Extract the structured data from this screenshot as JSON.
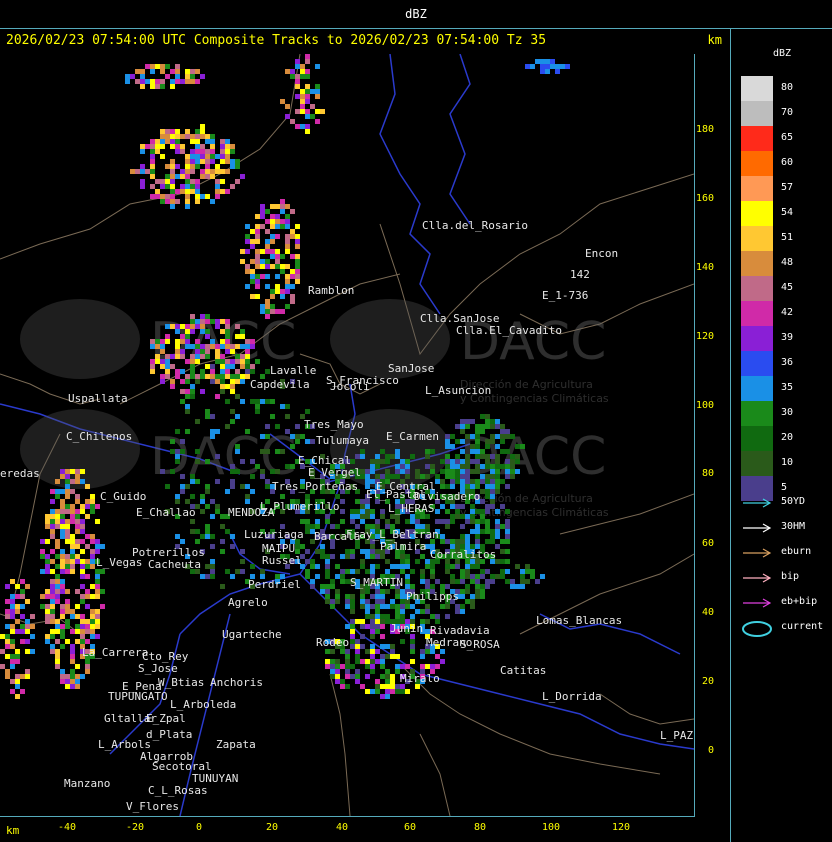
{
  "title": "dBZ",
  "header": {
    "text": "2026/02/23 07:54:00 UTC Composite Tracks to 2026/02/23 07:54:00 Tz 35",
    "unit": "km"
  },
  "x_axis": {
    "unit": "km",
    "ticks": [
      "-40",
      "-20",
      "0",
      "20",
      "40",
      "60",
      "80",
      "100",
      "120"
    ]
  },
  "y_axis": {
    "ticks": [
      "180",
      "160",
      "140",
      "120",
      "100",
      "80",
      "60",
      "40",
      "20",
      "0"
    ]
  },
  "legend": {
    "title": "dBZ",
    "levels": [
      {
        "label": "80",
        "color": "#d9d9d9"
      },
      {
        "label": "70",
        "color": "#bdbdbd"
      },
      {
        "label": "65",
        "color": "#ff2a1a"
      },
      {
        "label": "60",
        "color": "#ff6a00"
      },
      {
        "label": "57",
        "color": "#ff9955"
      },
      {
        "label": "54",
        "color": "#ffff00"
      },
      {
        "label": "51",
        "color": "#ffc832"
      },
      {
        "label": "48",
        "color": "#d88c3c"
      },
      {
        "label": "45",
        "color": "#c06a88"
      },
      {
        "label": "42",
        "color": "#d02aa8"
      },
      {
        "label": "39",
        "color": "#8a1fd6"
      },
      {
        "label": "36",
        "color": "#2a4cf0"
      },
      {
        "label": "35",
        "color": "#1a90e6"
      },
      {
        "label": "30",
        "color": "#1a8a1a"
      },
      {
        "label": "20",
        "color": "#106a10"
      },
      {
        "label": "10",
        "color": "#2a5a1a"
      },
      {
        "label": "5",
        "color": "#4a3e8c"
      }
    ],
    "tracks": [
      {
        "label": "50YD",
        "color": "#40d0e0"
      },
      {
        "label": "30HM",
        "color": "#ffffff"
      },
      {
        "label": "eburn",
        "color": "#d8a060"
      },
      {
        "label": "bip",
        "color": "#ffb0c0"
      },
      {
        "label": "eb+bip",
        "color": "#e040e0"
      },
      {
        "label": "current",
        "color": "#40d0e0"
      }
    ]
  },
  "places": [
    {
      "name": "Clla.del_Rosario"
    },
    {
      "name": "Encon"
    },
    {
      "name": "142"
    },
    {
      "name": "E_1-736"
    },
    {
      "name": "Ramblon"
    },
    {
      "name": "Clla.SanJose"
    },
    {
      "name": "Clla.El_Cavadito"
    },
    {
      "name": "S_Francisco"
    },
    {
      "name": "SanJose"
    },
    {
      "name": "L_Asuncion"
    },
    {
      "name": "Uspallata"
    },
    {
      "name": "Tres_Mayo"
    },
    {
      "name": "Tulumaya"
    },
    {
      "name": "E_Carmen"
    },
    {
      "name": "C_Chilenos"
    },
    {
      "name": "E_Chical"
    },
    {
      "name": "E_Vergel"
    },
    {
      "name": "Divisadero"
    },
    {
      "name": "E_Central"
    },
    {
      "name": "C_Guido"
    },
    {
      "name": "E_Challao"
    },
    {
      "name": "MENDOZA"
    },
    {
      "name": "Potrerillos"
    },
    {
      "name": "Cacheuta"
    },
    {
      "name": "Luzuriaga"
    },
    {
      "name": "MAIPU"
    },
    {
      "name": "Russel"
    },
    {
      "name": "Perdriel"
    },
    {
      "name": "L_Vegas"
    },
    {
      "name": "Agrelo"
    },
    {
      "name": "S_MARTIN"
    },
    {
      "name": "Ugarteche"
    },
    {
      "name": "Lomas_Blancas"
    },
    {
      "name": "S_ROSA"
    },
    {
      "name": "La_Carrera"
    },
    {
      "name": "Cto_Rey"
    },
    {
      "name": "S_Jose"
    },
    {
      "name": "Catitas"
    },
    {
      "name": "E_Pena"
    },
    {
      "name": "W_Btias"
    },
    {
      "name": "Anchoris"
    },
    {
      "name": "TUPUNGATO"
    },
    {
      "name": "L_Arboleda"
    },
    {
      "name": "L_Dorrida"
    },
    {
      "name": "Gltallar"
    },
    {
      "name": "E_Zpal"
    },
    {
      "name": "L_Arbols"
    },
    {
      "name": "d_Plata"
    },
    {
      "name": "Zapata"
    },
    {
      "name": "L_PAZ"
    },
    {
      "name": "Algarrob"
    },
    {
      "name": "Secotoral"
    },
    {
      "name": "TUNUYAN"
    },
    {
      "name": "Manzano"
    },
    {
      "name": "C_L_Rosas"
    },
    {
      "name": "V_Flores"
    },
    {
      "name": "Miralo"
    },
    {
      "name": "Rodeo"
    },
    {
      "name": "L_Plumerillo"
    },
    {
      "name": "Junin"
    },
    {
      "name": "Rivadavia"
    },
    {
      "name": "Medrano"
    },
    {
      "name": "eredas"
    },
    {
      "name": "Lavalle"
    },
    {
      "name": "Capdevila"
    },
    {
      "name": "Jocoli"
    },
    {
      "name": "El_Pastal"
    },
    {
      "name": "Corralitos"
    },
    {
      "name": "L_HERAS"
    },
    {
      "name": "Palmira"
    },
    {
      "name": "Barcala"
    },
    {
      "name": "Fray_L_Beltran"
    },
    {
      "name": "Philipps"
    },
    {
      "name": "Tres_Porteñas"
    }
  ],
  "watermark": {
    "brand": "DACC",
    "line1": "Dirección de Agricultura",
    "line2": "y Contingencias Climáticas"
  }
}
